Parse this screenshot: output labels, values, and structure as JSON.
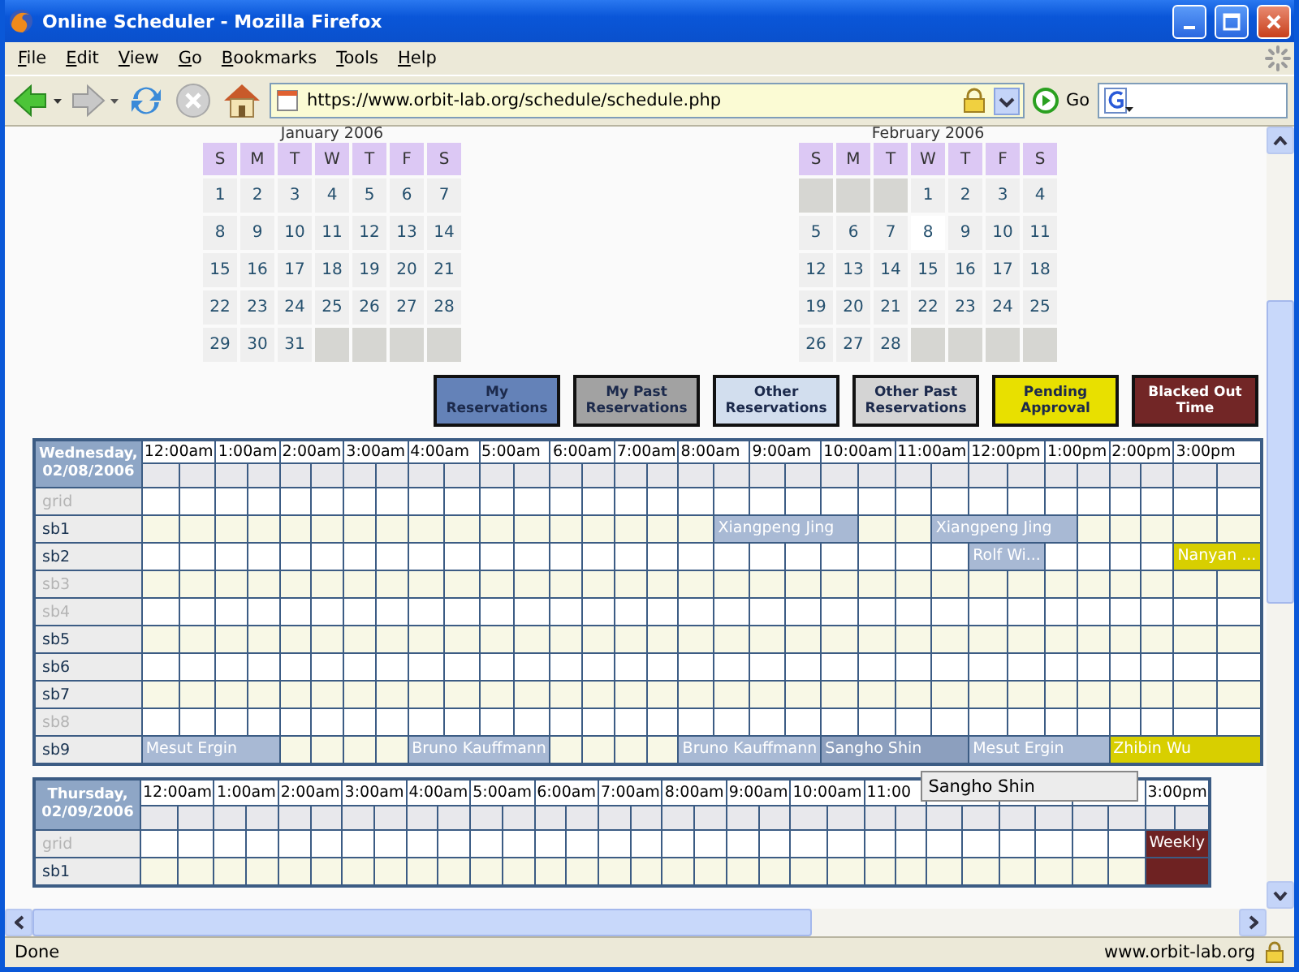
{
  "window": {
    "title": "Online Scheduler - Mozilla Firefox"
  },
  "menu": [
    "File",
    "Edit",
    "View",
    "Go",
    "Bookmarks",
    "Tools",
    "Help"
  ],
  "toolbar": {
    "url": "https://www.orbit-lab.org/schedule/schedule.php",
    "go_label": "Go"
  },
  "calendars": [
    {
      "title": "January 2006",
      "weekdays": [
        "S",
        "M",
        "T",
        "W",
        "T",
        "F",
        "S"
      ],
      "weeks": [
        [
          {
            "kind": "day",
            "day": "1",
            "selected": false
          },
          {
            "kind": "day",
            "day": "2",
            "selected": false
          },
          {
            "kind": "day",
            "day": "3",
            "selected": false
          },
          {
            "kind": "day",
            "day": "4",
            "selected": false
          },
          {
            "kind": "day",
            "day": "5",
            "selected": false
          },
          {
            "kind": "day",
            "day": "6",
            "selected": false
          },
          {
            "kind": "day",
            "day": "7",
            "selected": false
          }
        ],
        [
          {
            "kind": "day",
            "day": "8",
            "selected": false
          },
          {
            "kind": "day",
            "day": "9",
            "selected": false
          },
          {
            "kind": "day",
            "day": "10",
            "selected": false
          },
          {
            "kind": "day",
            "day": "11",
            "selected": false
          },
          {
            "kind": "day",
            "day": "12",
            "selected": false
          },
          {
            "kind": "day",
            "day": "13",
            "selected": false
          },
          {
            "kind": "day",
            "day": "14",
            "selected": false
          }
        ],
        [
          {
            "kind": "day",
            "day": "15",
            "selected": false
          },
          {
            "kind": "day",
            "day": "16",
            "selected": false
          },
          {
            "kind": "day",
            "day": "17",
            "selected": false
          },
          {
            "kind": "day",
            "day": "18",
            "selected": false
          },
          {
            "kind": "day",
            "day": "19",
            "selected": false
          },
          {
            "kind": "day",
            "day": "20",
            "selected": false
          },
          {
            "kind": "day",
            "day": "21",
            "selected": false
          }
        ],
        [
          {
            "kind": "day",
            "day": "22",
            "selected": false
          },
          {
            "kind": "day",
            "day": "23",
            "selected": false
          },
          {
            "kind": "day",
            "day": "24",
            "selected": false
          },
          {
            "kind": "day",
            "day": "25",
            "selected": false
          },
          {
            "kind": "day",
            "day": "26",
            "selected": false
          },
          {
            "kind": "day",
            "day": "27",
            "selected": false
          },
          {
            "kind": "day",
            "day": "28",
            "selected": false
          }
        ],
        [
          {
            "kind": "day",
            "day": "29",
            "selected": false
          },
          {
            "kind": "day",
            "day": "30",
            "selected": false
          },
          {
            "kind": "day",
            "day": "31",
            "selected": false
          },
          {
            "kind": "blank"
          },
          {
            "kind": "blank"
          },
          {
            "kind": "blank"
          },
          {
            "kind": "blank"
          }
        ]
      ]
    },
    {
      "title": "February 2006",
      "weekdays": [
        "S",
        "M",
        "T",
        "W",
        "T",
        "F",
        "S"
      ],
      "weeks": [
        [
          {
            "kind": "blank"
          },
          {
            "kind": "blank"
          },
          {
            "kind": "blank"
          },
          {
            "kind": "day",
            "day": "1",
            "selected": false
          },
          {
            "kind": "day",
            "day": "2",
            "selected": false
          },
          {
            "kind": "day",
            "day": "3",
            "selected": false
          },
          {
            "kind": "day",
            "day": "4",
            "selected": false
          }
        ],
        [
          {
            "kind": "day",
            "day": "5",
            "selected": false
          },
          {
            "kind": "day",
            "day": "6",
            "selected": false
          },
          {
            "kind": "day",
            "day": "7",
            "selected": false
          },
          {
            "kind": "day",
            "day": "8",
            "selected": true
          },
          {
            "kind": "day",
            "day": "9",
            "selected": false
          },
          {
            "kind": "day",
            "day": "10",
            "selected": false
          },
          {
            "kind": "day",
            "day": "11",
            "selected": false
          }
        ],
        [
          {
            "kind": "day",
            "day": "12",
            "selected": false
          },
          {
            "kind": "day",
            "day": "13",
            "selected": false
          },
          {
            "kind": "day",
            "day": "14",
            "selected": false
          },
          {
            "kind": "day",
            "day": "15",
            "selected": false
          },
          {
            "kind": "day",
            "day": "16",
            "selected": false
          },
          {
            "kind": "day",
            "day": "17",
            "selected": false
          },
          {
            "kind": "day",
            "day": "18",
            "selected": false
          }
        ],
        [
          {
            "kind": "day",
            "day": "19",
            "selected": false
          },
          {
            "kind": "day",
            "day": "20",
            "selected": false
          },
          {
            "kind": "day",
            "day": "21",
            "selected": false
          },
          {
            "kind": "day",
            "day": "22",
            "selected": false
          },
          {
            "kind": "day",
            "day": "23",
            "selected": false
          },
          {
            "kind": "day",
            "day": "24",
            "selected": false
          },
          {
            "kind": "day",
            "day": "25",
            "selected": false
          }
        ],
        [
          {
            "kind": "day",
            "day": "26",
            "selected": false
          },
          {
            "kind": "day",
            "day": "27",
            "selected": false
          },
          {
            "kind": "day",
            "day": "28",
            "selected": false
          },
          {
            "kind": "blank"
          },
          {
            "kind": "blank"
          },
          {
            "kind": "blank"
          },
          {
            "kind": "blank"
          }
        ]
      ]
    }
  ],
  "legend": [
    {
      "label": "My Reservations",
      "color": "#6482b8"
    },
    {
      "label": "My Past Reservations",
      "color": "#a2a2a2"
    },
    {
      "label": "Other Reservations",
      "color": "#d2deee"
    },
    {
      "label": "Other Past Reservations",
      "color": "#d4d4d4"
    },
    {
      "label": "Pending Approval",
      "color": "#e8e000"
    },
    {
      "label": "Blacked Out Time",
      "color": "#722626"
    }
  ],
  "schedule": [
    {
      "date_label": "Wednesday, 02/08/2006",
      "hours": [
        {
          "kind": "label",
          "text": "12:00am"
        },
        {
          "kind": "label",
          "text": "1:00am"
        },
        {
          "kind": "label",
          "text": "2:00am"
        },
        {
          "kind": "label",
          "text": "3:00am"
        },
        {
          "kind": "label",
          "text": "4:00am"
        },
        {
          "kind": "label",
          "text": "5:00am"
        },
        {
          "kind": "label",
          "text": "6:00am"
        },
        {
          "kind": "label",
          "text": "7:00am"
        },
        {
          "kind": "label",
          "text": "8:00am"
        },
        {
          "kind": "label",
          "text": "9:00am"
        },
        {
          "kind": "label",
          "text": "10:00am"
        },
        {
          "kind": "label",
          "text": "11:00am"
        },
        {
          "kind": "label",
          "text": "12:00pm"
        },
        {
          "kind": "label",
          "text": "1:00pm"
        },
        {
          "kind": "label",
          "text": "2:00pm"
        },
        {
          "kind": "label",
          "text": "3:00pm"
        }
      ],
      "rows": [
        {
          "name": "grid",
          "disabled": true
        },
        {
          "name": "sb1",
          "disabled": false,
          "cells": [
            {
              "kind": "free"
            },
            {
              "kind": "free"
            },
            {
              "kind": "free"
            },
            {
              "kind": "free"
            },
            {
              "kind": "free"
            },
            {
              "kind": "free"
            },
            {
              "kind": "free"
            },
            {
              "kind": "free"
            },
            {
              "kind": "free"
            },
            {
              "kind": "free"
            },
            {
              "kind": "free"
            },
            {
              "kind": "free"
            },
            {
              "kind": "free"
            },
            {
              "kind": "free"
            },
            {
              "kind": "free"
            },
            {
              "kind": "free"
            },
            {
              "kind": "free"
            },
            {
              "kind": "booking",
              "name": "Xiangpeng Jing",
              "color": "#a8b9d4"
            },
            {
              "kind": "continued"
            },
            {
              "kind": "continued"
            },
            {
              "kind": "continued"
            },
            {
              "kind": "free"
            },
            {
              "kind": "free"
            },
            {
              "kind": "booking",
              "name": "Xiangpeng Jing",
              "color": "#a8b9d4"
            },
            {
              "kind": "continued"
            },
            {
              "kind": "continued"
            },
            {
              "kind": "continued"
            }
          ]
        },
        {
          "name": "sb2",
          "disabled": false,
          "cells": [
            {
              "kind": "free"
            },
            {
              "kind": "free"
            },
            {
              "kind": "free"
            },
            {
              "kind": "free"
            },
            {
              "kind": "free"
            },
            {
              "kind": "free"
            },
            {
              "kind": "free"
            },
            {
              "kind": "free"
            },
            {
              "kind": "free"
            },
            {
              "kind": "free"
            },
            {
              "kind": "free"
            },
            {
              "kind": "free"
            },
            {
              "kind": "free"
            },
            {
              "kind": "free"
            },
            {
              "kind": "free"
            },
            {
              "kind": "free"
            },
            {
              "kind": "free"
            },
            {
              "kind": "free"
            },
            {
              "kind": "free"
            },
            {
              "kind": "free"
            },
            {
              "kind": "free"
            },
            {
              "kind": "free"
            },
            {
              "kind": "free"
            },
            {
              "kind": "free"
            },
            {
              "kind": "booking",
              "name": "Rolf Wi...",
              "color": "#a8b9d4"
            },
            {
              "kind": "continued"
            },
            {
              "kind": "free"
            },
            {
              "kind": "free"
            },
            {
              "kind": "free"
            },
            {
              "kind": "free"
            },
            {
              "kind": "booking",
              "name": "Nanyan ...",
              "color": "#d8cf00"
            },
            {
              "kind": "continued"
            }
          ]
        },
        {
          "name": "sb3",
          "disabled": true
        },
        {
          "name": "sb4",
          "disabled": true
        },
        {
          "name": "sb5",
          "disabled": false
        },
        {
          "name": "sb6",
          "disabled": false
        },
        {
          "name": "sb7",
          "disabled": false
        },
        {
          "name": "sb8",
          "disabled": true
        },
        {
          "name": "sb9",
          "disabled": false,
          "cells": [
            {
              "kind": "booking",
              "name": "Mesut Ergin",
              "color": "#a8b9d4"
            },
            {
              "kind": "continued"
            },
            {
              "kind": "continued"
            },
            {
              "kind": "continued"
            },
            {
              "kind": "free"
            },
            {
              "kind": "free"
            },
            {
              "kind": "free"
            },
            {
              "kind": "free"
            },
            {
              "kind": "booking",
              "name": "Bruno Kauffmann",
              "color": "#a8b9d4"
            },
            {
              "kind": "continued"
            },
            {
              "kind": "continued"
            },
            {
              "kind": "continued"
            },
            {
              "kind": "free"
            },
            {
              "kind": "free"
            },
            {
              "kind": "free"
            },
            {
              "kind": "free"
            },
            {
              "kind": "booking",
              "name": "Bruno Kauffmann",
              "color": "#a8b9d4"
            },
            {
              "kind": "continued"
            },
            {
              "kind": "continued"
            },
            {
              "kind": "continued"
            },
            {
              "kind": "booking",
              "name": "Sangho Shin",
              "color": "#8c9fbe"
            },
            {
              "kind": "continued"
            },
            {
              "kind": "continued"
            },
            {
              "kind": "continued"
            },
            {
              "kind": "booking",
              "name": "Mesut Ergin",
              "color": "#a8b9d4"
            },
            {
              "kind": "continued"
            },
            {
              "kind": "continued"
            },
            {
              "kind": "continued"
            },
            {
              "kind": "booking",
              "name": "Zhibin Wu",
              "color": "#d8cf00"
            },
            {
              "kind": "continued"
            },
            {
              "kind": "continued"
            },
            {
              "kind": "continued"
            }
          ]
        }
      ]
    },
    {
      "date_label": "Thursday, 02/09/2006",
      "hours": [
        {
          "kind": "label",
          "text": "12:00am"
        },
        {
          "kind": "label",
          "text": "1:00am"
        },
        {
          "kind": "label",
          "text": "2:00am"
        },
        {
          "kind": "label",
          "text": "3:00am"
        },
        {
          "kind": "label",
          "text": "4:00am"
        },
        {
          "kind": "label",
          "text": "5:00am"
        },
        {
          "kind": "label",
          "text": "6:00am"
        },
        {
          "kind": "label",
          "text": "7:00am"
        },
        {
          "kind": "label",
          "text": "8:00am"
        },
        {
          "kind": "label",
          "text": "9:00am"
        },
        {
          "kind": "label",
          "text": "10:00am"
        },
        {
          "kind": "label",
          "text": "11:00"
        },
        {
          "kind": "covered"
        },
        {
          "kind": "covered"
        },
        {
          "kind": "covered"
        },
        {
          "kind": "label",
          "text": "3:00pm"
        }
      ],
      "tooltip": {
        "text": "Sangho Shin"
      },
      "rows": [
        {
          "name": "grid",
          "disabled": true,
          "cells": [
            {
              "kind": "free"
            },
            {
              "kind": "free"
            },
            {
              "kind": "free"
            },
            {
              "kind": "free"
            },
            {
              "kind": "free"
            },
            {
              "kind": "free"
            },
            {
              "kind": "free"
            },
            {
              "kind": "free"
            },
            {
              "kind": "free"
            },
            {
              "kind": "free"
            },
            {
              "kind": "free"
            },
            {
              "kind": "free"
            },
            {
              "kind": "free"
            },
            {
              "kind": "free"
            },
            {
              "kind": "free"
            },
            {
              "kind": "free"
            },
            {
              "kind": "free"
            },
            {
              "kind": "free"
            },
            {
              "kind": "free"
            },
            {
              "kind": "free"
            },
            {
              "kind": "free"
            },
            {
              "kind": "free"
            },
            {
              "kind": "free"
            },
            {
              "kind": "free"
            },
            {
              "kind": "free"
            },
            {
              "kind": "free"
            },
            {
              "kind": "free"
            },
            {
              "kind": "free"
            },
            {
              "kind": "free"
            },
            {
              "kind": "free"
            },
            {
              "kind": "booking",
              "name": "Weekly",
              "color": "#6e2222"
            },
            {
              "kind": "continued"
            }
          ]
        },
        {
          "name": "sb1",
          "disabled": false,
          "cells": [
            {
              "kind": "free"
            },
            {
              "kind": "free"
            },
            {
              "kind": "free"
            },
            {
              "kind": "free"
            },
            {
              "kind": "free"
            },
            {
              "kind": "free"
            },
            {
              "kind": "free"
            },
            {
              "kind": "free"
            },
            {
              "kind": "free"
            },
            {
              "kind": "free"
            },
            {
              "kind": "free"
            },
            {
              "kind": "free"
            },
            {
              "kind": "free"
            },
            {
              "kind": "free"
            },
            {
              "kind": "free"
            },
            {
              "kind": "free"
            },
            {
              "kind": "free"
            },
            {
              "kind": "free"
            },
            {
              "kind": "free"
            },
            {
              "kind": "free"
            },
            {
              "kind": "free"
            },
            {
              "kind": "free"
            },
            {
              "kind": "free"
            },
            {
              "kind": "free"
            },
            {
              "kind": "free"
            },
            {
              "kind": "free"
            },
            {
              "kind": "free"
            },
            {
              "kind": "free"
            },
            {
              "kind": "free"
            },
            {
              "kind": "free"
            },
            {
              "kind": "booking",
              "color": "#6e2222"
            },
            {
              "kind": "continued"
            }
          ]
        }
      ]
    }
  ],
  "status_bar": {
    "text": "Done",
    "site": "www.orbit-lab.org"
  }
}
